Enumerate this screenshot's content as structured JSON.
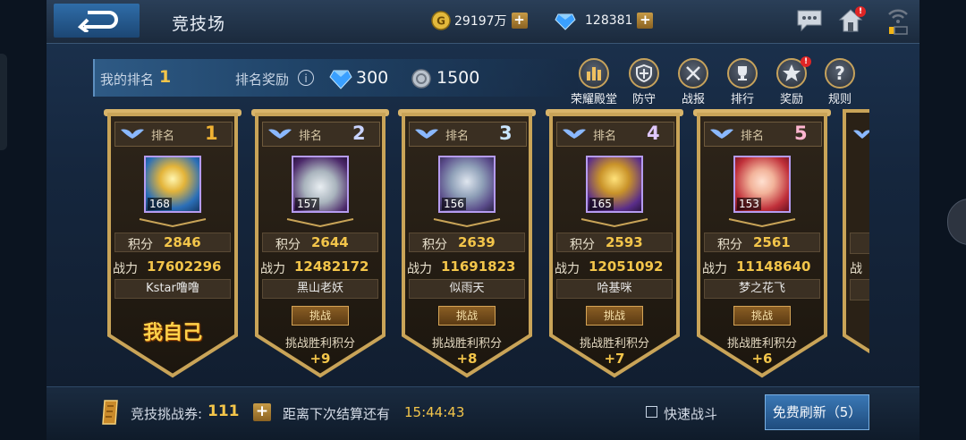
{
  "header": {
    "title": "竞技场",
    "gold": "29197万",
    "diamonds": "128381",
    "plus": "+",
    "mail_badge": "!"
  },
  "rank_bar": {
    "my_rank_label": "我的排名",
    "my_rank_value": "1",
    "reward_label": "排名奖励",
    "info": "i",
    "reward_diamonds": "300",
    "reward_coins": "1500"
  },
  "menu": [
    {
      "label": "荣耀殿堂",
      "icon": "hall-of-fame-icon"
    },
    {
      "label": "防守",
      "icon": "shield-icon"
    },
    {
      "label": "战报",
      "icon": "crossed-swords-icon"
    },
    {
      "label": "排行",
      "icon": "trophy-icon"
    },
    {
      "label": "奖励",
      "icon": "star-icon",
      "badge": "!"
    },
    {
      "label": "规则",
      "icon": "question-icon"
    }
  ],
  "rank_label": "排名",
  "score_label": "积分",
  "power_label": "战力",
  "challenge_label": "挑战",
  "win_score_label": "挑战胜利积分",
  "self_label": "我自己",
  "players": [
    {
      "rank": "1",
      "level": "168",
      "score": "2846",
      "power": "17602296",
      "name": "Kstar噜噜",
      "self": true,
      "rank_color": "#f0b233"
    },
    {
      "rank": "2",
      "level": "157",
      "score": "2644",
      "power": "12482172",
      "name": "黑山老妖",
      "win_bonus": "+9",
      "rank_color": "#c9d3ff"
    },
    {
      "rank": "3",
      "level": "156",
      "score": "2639",
      "power": "11691823",
      "name": "似雨天",
      "win_bonus": "+8",
      "rank_color": "#c9e6ff"
    },
    {
      "rank": "4",
      "level": "165",
      "score": "2593",
      "power": "12051092",
      "name": "哈基咪",
      "win_bonus": "+7",
      "rank_color": "#e0c8ff"
    },
    {
      "rank": "5",
      "level": "153",
      "score": "2561",
      "power": "11148640",
      "name": "梦之花飞",
      "win_bonus": "+6",
      "rank_color": "#ffb6d0"
    }
  ],
  "partial_card": {
    "power_label": "战力"
  },
  "bottom": {
    "ticket_label": "竞技挑战券:",
    "ticket_value": "111",
    "settle_label": "距离下次结算还有",
    "settle_time": "15:44:43",
    "quick_battle": "快速战斗",
    "refresh": "免费刷新（5）"
  }
}
